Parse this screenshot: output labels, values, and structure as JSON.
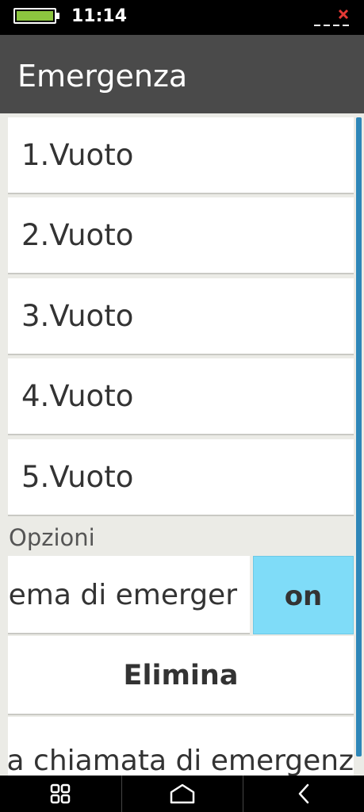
{
  "status_bar": {
    "time": "11:14",
    "battery_color": "#8cc63f",
    "signal_icon": "no-signal-icon"
  },
  "header": {
    "title": "Emergenza"
  },
  "emergency_slots": [
    {
      "label": "1.Vuoto"
    },
    {
      "label": "2.Vuoto"
    },
    {
      "label": "3.Vuoto"
    },
    {
      "label": "4.Vuoto"
    },
    {
      "label": "5.Vuoto"
    }
  ],
  "options": {
    "section_label": "Opzioni",
    "system_label": "ema di emerger",
    "system_toggle": "on",
    "toggle_color": "#7fdcf8",
    "delete_label": "Elimina",
    "call_label": "a chiamata di emergenz"
  },
  "scrollbar_color": "#2e86b8",
  "nav_bar": {
    "icons": [
      "recent-apps-icon",
      "home-icon",
      "back-icon"
    ]
  }
}
